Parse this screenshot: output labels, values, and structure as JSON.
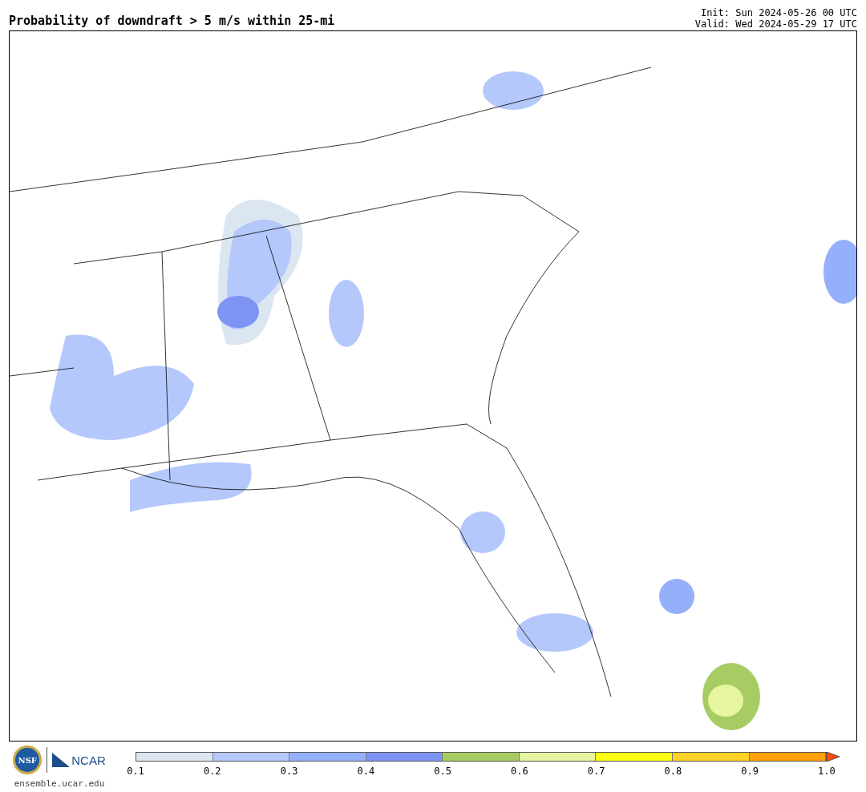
{
  "title": "Probability of downdraft > 5 m/s within 25-mi",
  "init": "Init: Sun 2024-05-26 00 UTC",
  "valid": "Valid: Wed 2024-05-29 17 UTC",
  "logos": {
    "left": "NSF",
    "right": "NCAR",
    "url": "ensemble.ucar.edu"
  },
  "colorbar": {
    "bins": [
      {
        "color": "#dbe6f1"
      },
      {
        "color": "#b4c8fb"
      },
      {
        "color": "#94b0fa"
      },
      {
        "color": "#7d94f5"
      },
      {
        "color": "#a8cc64"
      },
      {
        "color": "#e6f5a0"
      },
      {
        "color": "#ffff14"
      },
      {
        "color": "#ffd228"
      },
      {
        "color": "#ff9f0a"
      },
      {
        "kind": "extend",
        "color": "#ff4a0a"
      }
    ],
    "ticks": [
      "0.1",
      "0.2",
      "0.3",
      "0.4",
      "0.5",
      "0.6",
      "0.7",
      "0.8",
      "0.9",
      "1.0"
    ]
  }
}
